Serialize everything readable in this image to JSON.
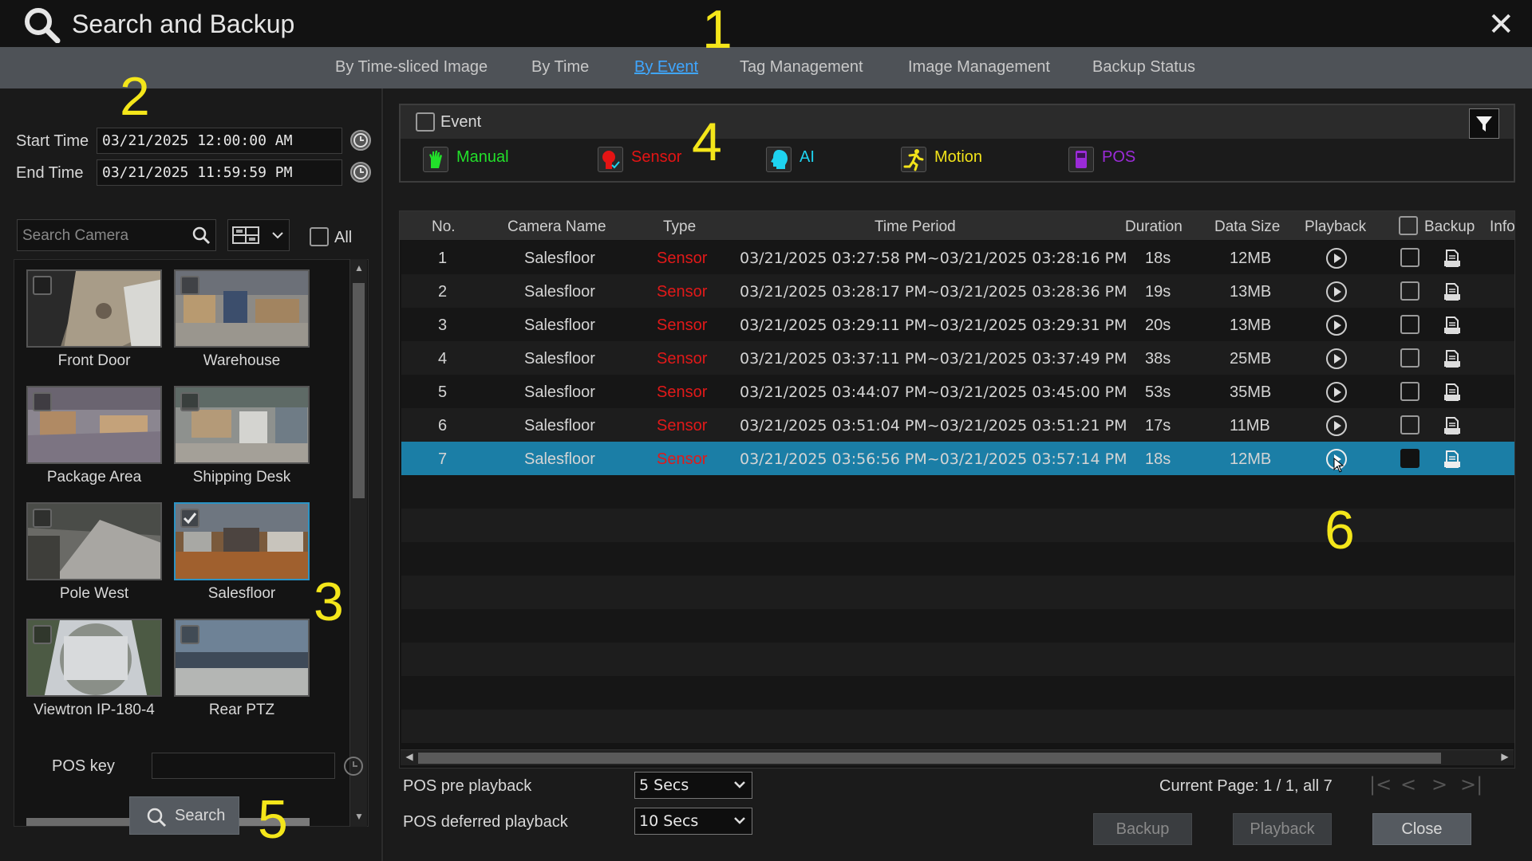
{
  "window": {
    "title": "Search and Backup",
    "close_glyph": "✕"
  },
  "tabs": [
    {
      "label": "By Time-sliced Image"
    },
    {
      "label": "By Time"
    },
    {
      "label": "By Event"
    },
    {
      "label": "Tag Management"
    },
    {
      "label": "Image Management"
    },
    {
      "label": "Backup Status"
    }
  ],
  "active_tab": "By Event",
  "annotations": [
    "1",
    "2",
    "3",
    "4",
    "5",
    "6"
  ],
  "left": {
    "start_time_label": "Start Time",
    "start_time_value": "03/21/2025 12:00:00 AM",
    "end_time_label": "End Time",
    "end_time_value": "03/21/2025 11:59:59 PM",
    "search_camera_placeholder": "Search Camera",
    "all_label": "All",
    "cameras": [
      {
        "name": "Front Door",
        "checked": false
      },
      {
        "name": "Warehouse",
        "checked": false
      },
      {
        "name": "Package Area",
        "checked": false
      },
      {
        "name": "Shipping Desk",
        "checked": false
      },
      {
        "name": "Pole West",
        "checked": false
      },
      {
        "name": "Salesfloor",
        "checked": true
      },
      {
        "name": "Viewtron IP-180-4",
        "checked": false
      },
      {
        "name": "Rear PTZ",
        "checked": false
      }
    ],
    "pos_key_label": "POS key",
    "pos_key_value": "",
    "search_button": "Search"
  },
  "events": {
    "header_label": "Event",
    "types": [
      {
        "label": "Manual",
        "color": "#22e02a"
      },
      {
        "label": "Sensor",
        "color": "#e41414"
      },
      {
        "label": "AI",
        "color": "#1ed3f0"
      },
      {
        "label": "Motion",
        "color": "#f2e31a"
      },
      {
        "label": "POS",
        "color": "#9b2bd8"
      }
    ]
  },
  "table": {
    "columns": [
      "No.",
      "Camera Name",
      "Type",
      "Time Period",
      "Duration",
      "Data Size",
      "Playback",
      "Backup",
      "Info"
    ],
    "rows": [
      {
        "no": "1",
        "camera": "Salesfloor",
        "type": "Sensor",
        "period": "03/21/2025 03:27:58 PM~03/21/2025 03:28:16 PM",
        "duration": "18s",
        "size": "12MB",
        "selected": false
      },
      {
        "no": "2",
        "camera": "Salesfloor",
        "type": "Sensor",
        "period": "03/21/2025 03:28:17 PM~03/21/2025 03:28:36 PM",
        "duration": "19s",
        "size": "13MB",
        "selected": false
      },
      {
        "no": "3",
        "camera": "Salesfloor",
        "type": "Sensor",
        "period": "03/21/2025 03:29:11 PM~03/21/2025 03:29:31 PM",
        "duration": "20s",
        "size": "13MB",
        "selected": false
      },
      {
        "no": "4",
        "camera": "Salesfloor",
        "type": "Sensor",
        "period": "03/21/2025 03:37:11 PM~03/21/2025 03:37:49 PM",
        "duration": "38s",
        "size": "25MB",
        "selected": false
      },
      {
        "no": "5",
        "camera": "Salesfloor",
        "type": "Sensor",
        "period": "03/21/2025 03:44:07 PM~03/21/2025 03:45:00 PM",
        "duration": "53s",
        "size": "35MB",
        "selected": false
      },
      {
        "no": "6",
        "camera": "Salesfloor",
        "type": "Sensor",
        "period": "03/21/2025 03:51:04 PM~03/21/2025 03:51:21 PM",
        "duration": "17s",
        "size": "11MB",
        "selected": false
      },
      {
        "no": "7",
        "camera": "Salesfloor",
        "type": "Sensor",
        "period": "03/21/2025 03:56:56 PM~03/21/2025 03:57:14 PM",
        "duration": "18s",
        "size": "12MB",
        "selected": true
      }
    ]
  },
  "bottom": {
    "pos_pre_label": "POS pre playback",
    "pos_pre_value": "5 Secs",
    "pos_deferred_label": "POS deferred playback",
    "pos_deferred_value": "10 Secs",
    "page_info": "Current Page: 1 / 1, all 7",
    "backup_button": "Backup",
    "playback_button": "Playback",
    "close_button": "Close"
  },
  "colors": {
    "accent": "#1b7ea6",
    "tab_active": "#3fa6ff",
    "sensor": "#e11919",
    "annotation": "#f4e61a"
  }
}
